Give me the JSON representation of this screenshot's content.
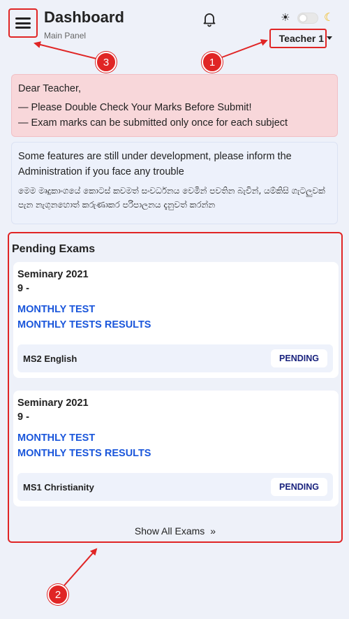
{
  "header": {
    "title": "Dashboard",
    "subtitle": "Main Panel",
    "user_label": "Teacher 1",
    "sun_icon": "☀",
    "moon_icon": "☾"
  },
  "alert": {
    "greeting": "Dear Teacher,",
    "line1": "— Please Double Check Your Marks Before Submit!",
    "line2": "— Exam marks can be submitted only once for each subject"
  },
  "info": {
    "english": "Some features are still under development, please inform the Administration if you face any trouble",
    "sinhala": "මෙම මෘදුකාංගයේ කොටස් කවමත් සංවර්ධනය වෙමින් පවතින බැවින්, යම්කිසි ගැටලුවක් පැන නැගුනහොත් කරුණාකර පරිපාලනය දැනුවත් කරන්න"
  },
  "pending": {
    "title": "Pending Exams",
    "exams": [
      {
        "institution": "Seminary 2021",
        "grade": "9 -",
        "test": "MONTHLY TEST",
        "results": "MONTHLY TESTS RESULTS",
        "subject": "MS2 English",
        "status": "PENDING"
      },
      {
        "institution": "Seminary 2021",
        "grade": "9 -",
        "test": "MONTHLY TEST",
        "results": "MONTHLY TESTS RESULTS",
        "subject": "MS1 Christianity",
        "status": "PENDING"
      }
    ],
    "show_all": "Show All Exams",
    "show_all_chevron": "»"
  },
  "callouts": [
    "1",
    "2",
    "3"
  ],
  "colors": {
    "annotation_red": "#e02525",
    "link_blue": "#1a56db",
    "status_navy": "#1a237e",
    "alert_bg": "#f8d7da",
    "page_bg": "#eef1f9"
  }
}
